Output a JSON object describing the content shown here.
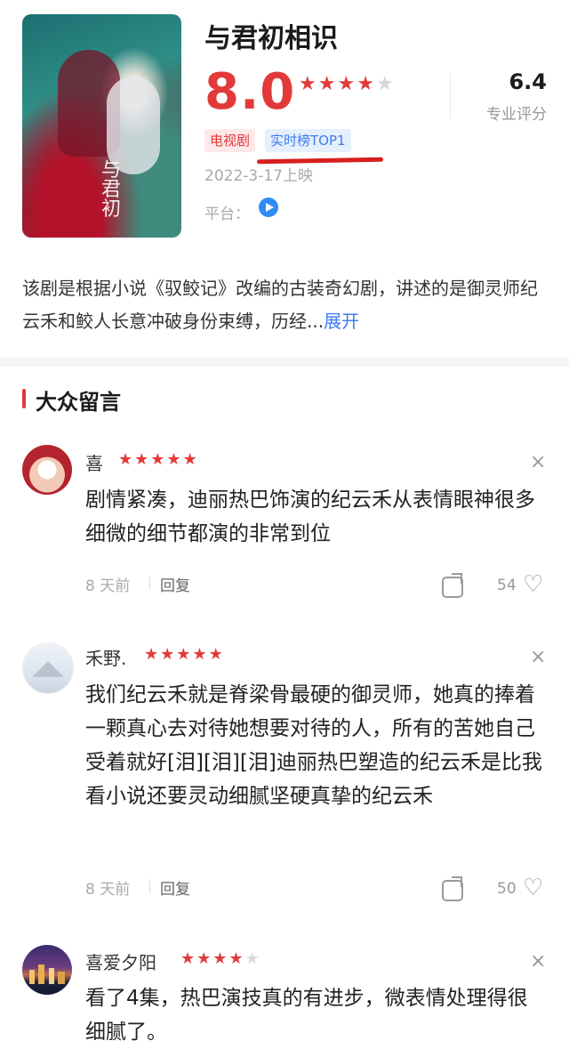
{
  "show": {
    "title": "与君初相识",
    "score": "8.0",
    "rating_stars": 4,
    "pro_score": "6.4",
    "pro_label": "专业评分",
    "tags": [
      "电视剧",
      "实时榜TOP1"
    ],
    "release": "2022-3-17上映",
    "platform_label": "平台：",
    "platform_icon": "tencent-video-icon",
    "synopsis": "该剧是根据小说《驭鲛记》改编的古装奇幻剧，讲述的是御灵师纪云禾和鲛人长意冲破身份束缚，历经...",
    "expand": "展开",
    "poster_text": "与君初相识"
  },
  "section": {
    "title": "大众留言"
  },
  "comments": [
    {
      "name": "喜",
      "stars": 5,
      "text": "剧情紧凑，迪丽热巴饰演的纪云禾从表情眼神很多细微的细节都演的非常到位",
      "time": "8 天前",
      "reply": "回复",
      "likes": "54"
    },
    {
      "name": "禾野.",
      "stars": 5,
      "text": "我们纪云禾就是脊梁骨最硬的御灵师，她真的捧着一颗真心去对待她想要对待的人，所有的苦她自己受着就好[泪][泪][泪]迪丽热巴塑造的纪云禾是比我看小说还要灵动细腻坚硬真挚的纪云禾",
      "time": "8 天前",
      "reply": "回复",
      "likes": "50"
    },
    {
      "name": "喜爱夕阳",
      "stars": 4,
      "text": "看了4集，热巴演技真的有进步，微表情处理得很细腻了。"
    }
  ],
  "icons": {
    "close": "×",
    "star": "★",
    "heart": "♡"
  },
  "colors": {
    "accent": "#e23a3a",
    "link": "#3d7cf0"
  }
}
